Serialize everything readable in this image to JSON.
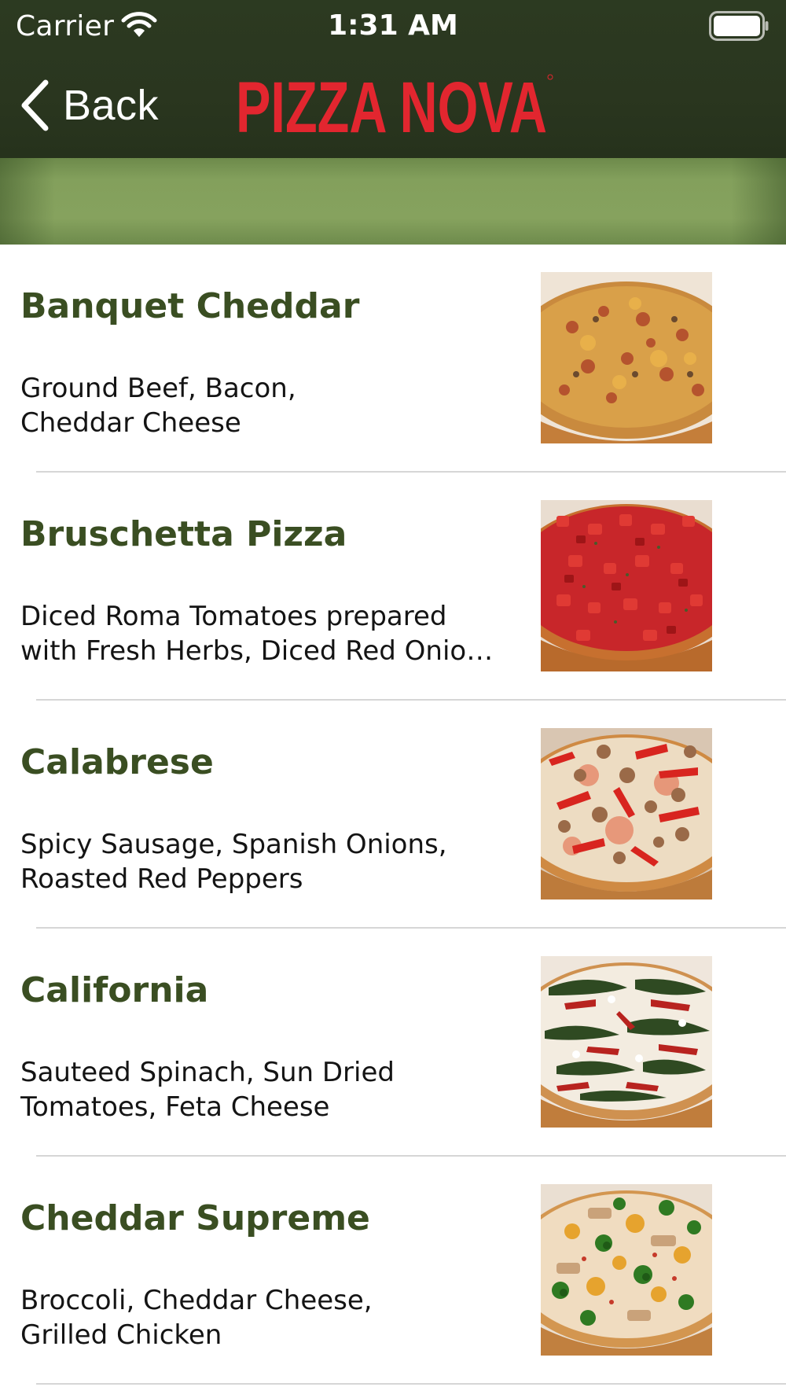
{
  "status_bar": {
    "carrier": "Carrier",
    "time": "1:31 AM",
    "wifi_icon": "wifi-icon",
    "battery_icon": "battery-icon"
  },
  "nav": {
    "back_label": "Back",
    "back_icon": "chevron-left-icon",
    "brand": "PIZZA NOVA",
    "brand_color": "#e2262f",
    "header_bg": "#2a361f",
    "banner_color": "#84a05c"
  },
  "menu": {
    "name_color": "#3a4e22",
    "items": [
      {
        "name": "Banquet Cheddar",
        "description": "Ground Beef, Bacon,\nCheddar Cheese",
        "photo": "banquet-cheddar-pizza-photo"
      },
      {
        "name": "Bruschetta Pizza",
        "description": "Diced Roma Tomatoes prepared\nwith Fresh Herbs, Diced Red Onio…",
        "photo": "bruschetta-pizza-photo"
      },
      {
        "name": "Calabrese",
        "description": "Spicy Sausage, Spanish Onions,\nRoasted Red Peppers",
        "photo": "calabrese-pizza-photo"
      },
      {
        "name": "California",
        "description": "Sauteed Spinach, Sun Dried\nTomatoes, Feta Cheese",
        "photo": "california-pizza-photo"
      },
      {
        "name": "Cheddar Supreme",
        "description": "Broccoli, Cheddar Cheese,\nGrilled Chicken",
        "photo": "cheddar-supreme-pizza-photo"
      }
    ]
  }
}
